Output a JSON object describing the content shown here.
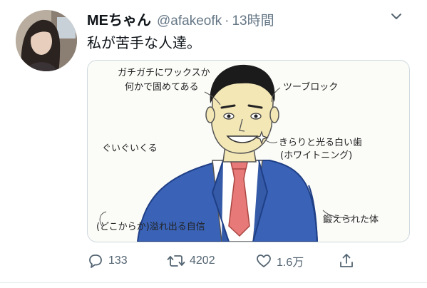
{
  "user": {
    "display_name": "MEちゃん",
    "handle": "@afakeofk",
    "separator": "·",
    "time": "13時間"
  },
  "tweet": {
    "text": "私が苦手な人達。"
  },
  "media": {
    "labels": {
      "wax_line1": "ガチガチにワックスか",
      "wax_line2": "何かで固めてある",
      "two_block": "ツーブロック",
      "teeth_line1": "きらりと光る白い歯",
      "teeth_line2": "(ホワイトニング)",
      "guigui": "ぐいぐいくる",
      "confidence": "(どこからか)溢れ出る自信",
      "body": "鍛えられた体"
    }
  },
  "actions": {
    "replies": "133",
    "retweets": "4202",
    "likes": "1.6万"
  },
  "icons": {
    "reply": "reply-icon",
    "retweet": "retweet-icon",
    "like": "heart-icon",
    "share": "share-icon",
    "more": "chevron-down-icon"
  },
  "colors": {
    "text": "#0f1419",
    "muted": "#657786",
    "suit": "#3a63b8",
    "tie": "#e77a78",
    "skin": "#f3e7b6"
  }
}
